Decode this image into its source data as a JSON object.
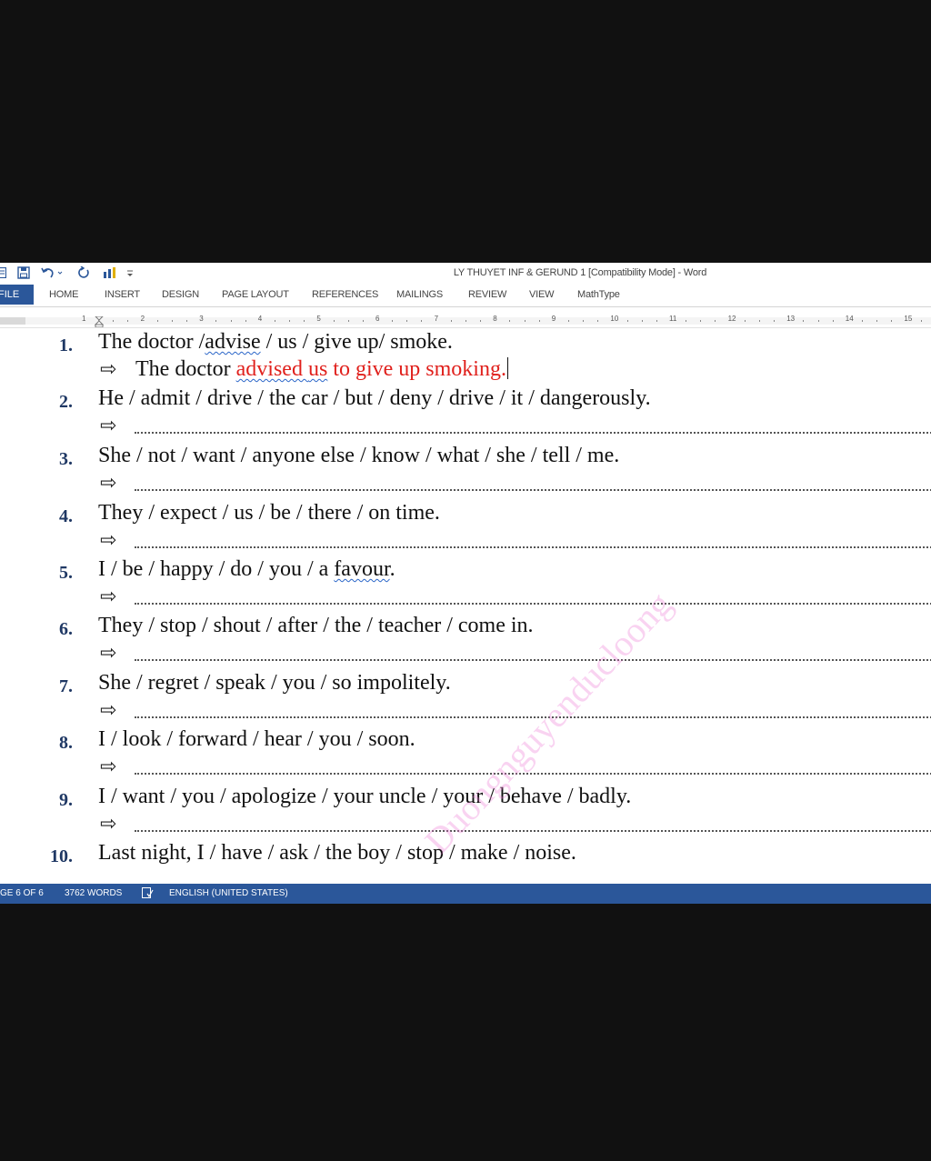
{
  "window": {
    "title": "LY THUYET INF & GERUND 1 [Compatibility Mode] - Word",
    "qat_icons": [
      "word-app-icon",
      "save-icon",
      "undo-icon",
      "redo-icon",
      "chart-icon",
      "customize-icon"
    ]
  },
  "ribbon": {
    "file_tab": "FILE",
    "tabs": [
      "HOME",
      "INSERT",
      "DESIGN",
      "PAGE LAYOUT",
      "REFERENCES",
      "MAILINGS",
      "REVIEW",
      "VIEW",
      "MathType"
    ]
  },
  "ruler": {
    "numbers": [
      "1",
      "2",
      "3",
      "4",
      "5",
      "6",
      "7",
      "8",
      "9",
      "10",
      "11",
      "12",
      "13",
      "14",
      "15"
    ]
  },
  "document": {
    "items": [
      {
        "number": "1.",
        "prompt_parts": [
          "The doctor /",
          "advise",
          " / us / give up/ smoke."
        ],
        "answer_parts": [
          "The doctor ",
          "advised ",
          "us",
          " to give up smoking."
        ]
      },
      {
        "number": "2.",
        "prompt": "He / admit / drive / the car / but / deny / drive / it / dangerously."
      },
      {
        "number": "3.",
        "prompt": "She / not / want / anyone else / know / what / she / tell / me."
      },
      {
        "number": "4.",
        "prompt": "They / expect / us / be / there / on time."
      },
      {
        "number": "5.",
        "prompt_parts": [
          "I / be / happy / do / you / a ",
          "favour",
          "."
        ]
      },
      {
        "number": "6.",
        "prompt": "They / stop / shout / after / the / teacher / come in."
      },
      {
        "number": "7.",
        "prompt": "She / regret / speak / you / so impolitely."
      },
      {
        "number": "8.",
        "prompt": "I / look / forward / hear / you / soon."
      },
      {
        "number": "9.",
        "prompt": "I / want / you / apologize / your uncle / your / behave / badly."
      },
      {
        "number": "10.",
        "prompt": "Last night, I / have / ask / the boy / stop / make / noise."
      }
    ],
    "arrow_symbol": "⇨",
    "watermark": "Duongnguyenducloong"
  },
  "status_bar": {
    "page": "GE 6 OF 6",
    "words": "3762 WORDS",
    "language": "ENGLISH (UNITED STATES)"
  },
  "colors": {
    "accent": "#2b579a",
    "answer_red": "#e0201c",
    "number_blue": "#1f3864",
    "watermark_pink": "#ec78d6"
  }
}
